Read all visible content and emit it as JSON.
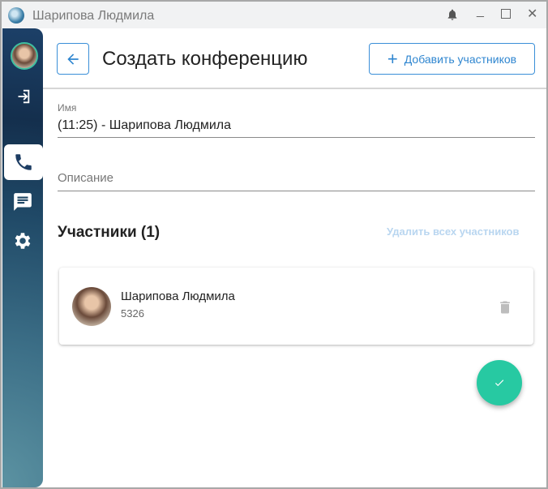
{
  "window": {
    "title": "Шарипова Людмила"
  },
  "header": {
    "title": "Создать конференцию",
    "add_label": "Добавить участников"
  },
  "form": {
    "name_label": "Имя",
    "name_value": "(11:25) - Шарипова Людмила",
    "description_placeholder": "Описание"
  },
  "participants": {
    "heading": "Участники (1)",
    "remove_all": "Удалить всех участников",
    "items": [
      {
        "name": "Шарипова Людмила",
        "number": "5326"
      }
    ]
  },
  "colors": {
    "accent": "#2f86d0",
    "fab": "#27c9a2",
    "sidebar": "#1f4866"
  }
}
